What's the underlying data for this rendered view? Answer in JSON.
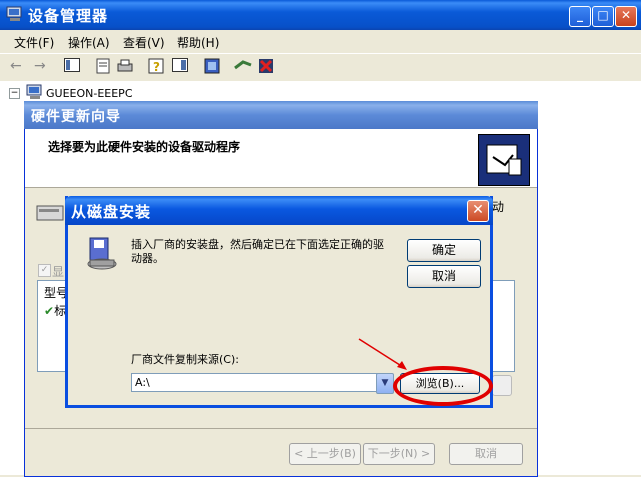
{
  "main_window": {
    "title": "设备管理器",
    "menus": [
      "文件(F)",
      "操作(A)",
      "查看(V)",
      "帮助(H)"
    ],
    "tree_root": "GUEEON-EEEPC"
  },
  "wizard": {
    "title": "硬件更新向导",
    "header_text": "选择要为此硬件安装的设备驱动程序",
    "partial_right": "动",
    "partial_check": "显",
    "partial_list_header": "型号",
    "partial_list_item": "标",
    "back_label": "< 上一步(B)",
    "next_label": "下一步(N) >",
    "cancel_label": "取消"
  },
  "dialog": {
    "title": "从磁盘安装",
    "message": "插入厂商的安装盘，然后确定已在下面选定正确的驱动器。",
    "ok_label": "确定",
    "cancel_label": "取消",
    "copy_from_label": "厂商文件复制来源(C):",
    "path_value": "A:\\",
    "browse_label": "浏览(B)..."
  },
  "colors": {
    "highlight_red": "#e00000"
  }
}
